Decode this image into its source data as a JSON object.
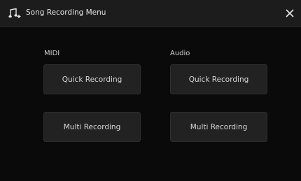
{
  "header": {
    "title": "Song Recording Menu",
    "icon": "music-note-icon",
    "close_icon": "close-icon"
  },
  "sections": {
    "midi": {
      "label": "MIDI",
      "quick_label": "Quick Recording",
      "multi_label": "Multi Recording"
    },
    "audio": {
      "label": "Audio",
      "quick_label": "Quick Recording",
      "multi_label": "Multi Recording"
    }
  },
  "colors": {
    "background": "#0a0a0a",
    "titlebar": "#1c1c1c",
    "button": "#222222",
    "text": "#d6d6d6"
  }
}
